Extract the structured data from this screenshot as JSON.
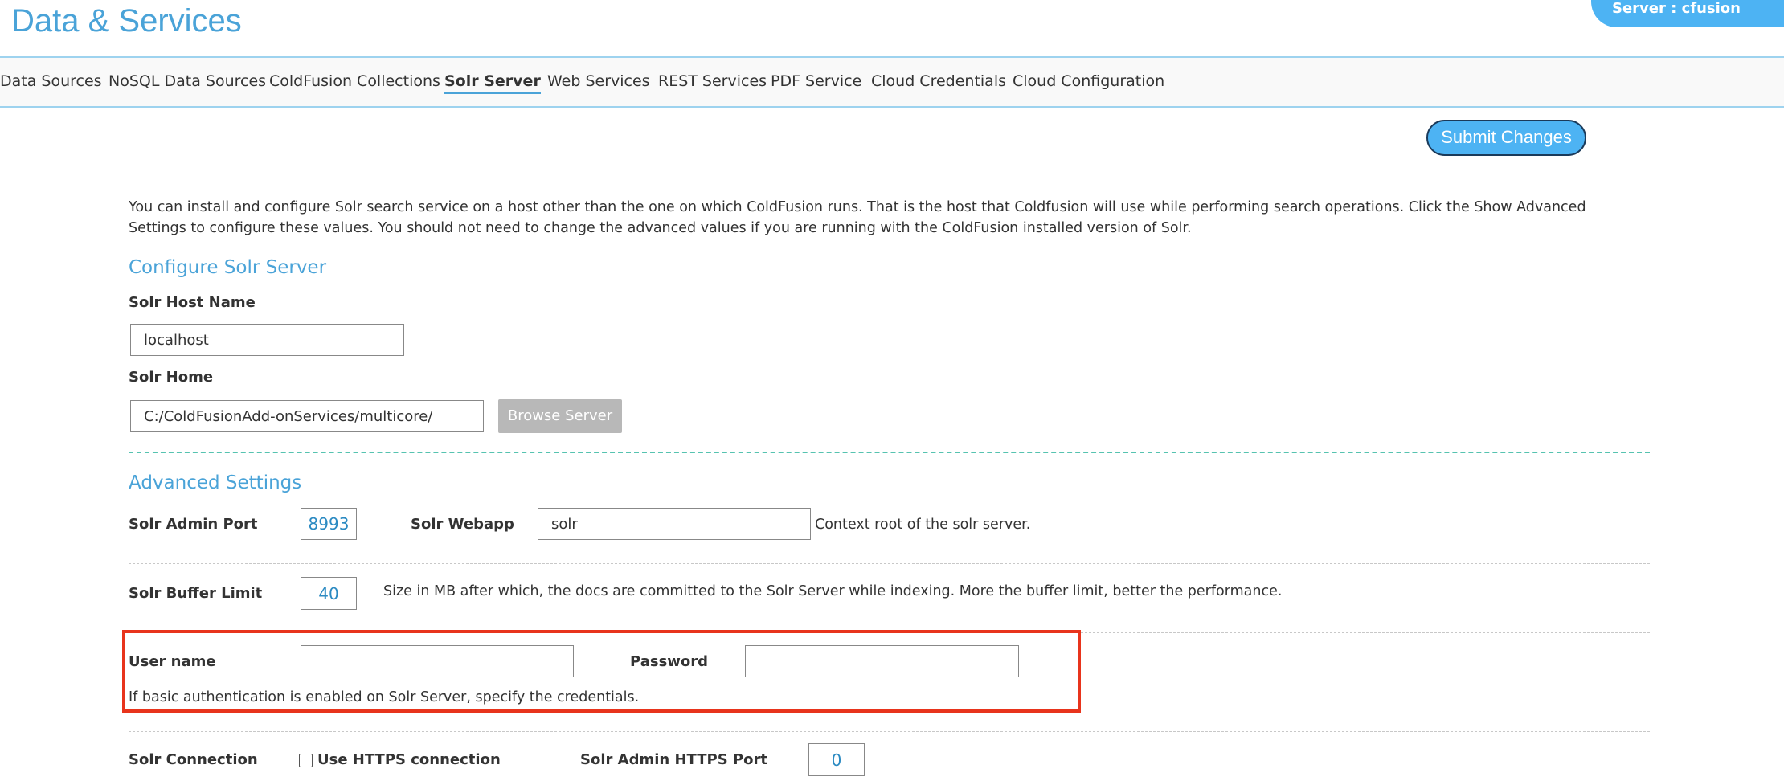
{
  "header": {
    "title": "Data & Services",
    "server_label": "Server : cfusion"
  },
  "nav": {
    "tabs": [
      {
        "label": "Data Sources"
      },
      {
        "label": "NoSQL Data Sources"
      },
      {
        "label": "ColdFusion Collections"
      },
      {
        "label": "Solr Server",
        "active": true
      },
      {
        "label": "Web Services"
      },
      {
        "label": "REST Services"
      },
      {
        "label": "PDF Service"
      },
      {
        "label": "Cloud Credentials"
      },
      {
        "label": "Cloud Configuration"
      }
    ]
  },
  "toolbar": {
    "submit_label": "Submit Changes"
  },
  "intro": {
    "description": "You can install and configure Solr search service on a host other than the one on which ColdFusion runs. That is the host that Coldfusion will use while performing search operations. Click the Show Advanced Settings to configure these values. You should not need to change the advanced values if you are running with the ColdFusion installed version of Solr."
  },
  "configure": {
    "heading": "Configure Solr Server",
    "host_label": "Solr Host Name",
    "host_value": "localhost",
    "home_label": "Solr Home",
    "home_value": "C:/ColdFusionAdd-onServices/multicore/",
    "browse_label": "Browse Server"
  },
  "advanced": {
    "heading": "Advanced Settings",
    "admin_port_label": "Solr Admin Port",
    "admin_port_value": "8993",
    "webapp_label": "Solr Webapp",
    "webapp_value": "solr",
    "webapp_hint": "Context root of the solr server.",
    "buffer_label": "Solr Buffer Limit",
    "buffer_value": "40",
    "buffer_hint": "Size in MB after which, the docs are committed to the Solr Server while indexing. More the buffer limit, better the performance.",
    "username_label": "User name",
    "username_value": "",
    "password_label": "Password",
    "password_value": "",
    "auth_hint": "If basic authentication is enabled on Solr Server, specify the credentials.",
    "connection_label": "Solr Connection",
    "https_checkbox_label": "Use HTTPS connection",
    "https_checked": false,
    "https_port_label": "Solr Admin HTTPS Port",
    "https_port_value": "0"
  },
  "colors": {
    "accent": "#4aa3d8",
    "button": "#4db3f3",
    "highlight_box": "#e8341c",
    "separator": "#56c3b0"
  }
}
